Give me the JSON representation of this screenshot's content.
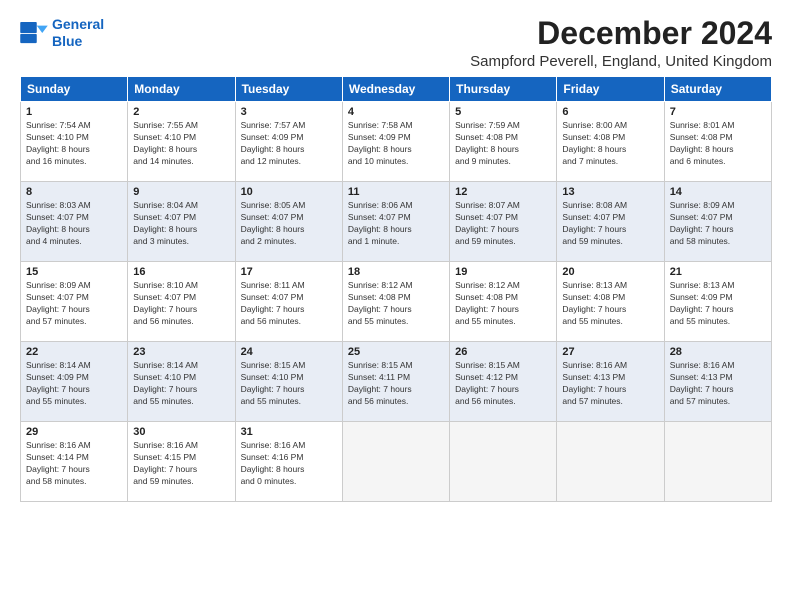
{
  "logo": {
    "line1": "General",
    "line2": "Blue"
  },
  "title": "December 2024",
  "subtitle": "Sampford Peverell, England, United Kingdom",
  "days_header": [
    "Sunday",
    "Monday",
    "Tuesday",
    "Wednesday",
    "Thursday",
    "Friday",
    "Saturday"
  ],
  "weeks": [
    [
      {
        "day": "1",
        "sunrise": "7:54 AM",
        "sunset": "4:10 PM",
        "daylight": "8 hours and 16 minutes."
      },
      {
        "day": "2",
        "sunrise": "7:55 AM",
        "sunset": "4:10 PM",
        "daylight": "8 hours and 14 minutes."
      },
      {
        "day": "3",
        "sunrise": "7:57 AM",
        "sunset": "4:09 PM",
        "daylight": "8 hours and 12 minutes."
      },
      {
        "day": "4",
        "sunrise": "7:58 AM",
        "sunset": "4:09 PM",
        "daylight": "8 hours and 10 minutes."
      },
      {
        "day": "5",
        "sunrise": "7:59 AM",
        "sunset": "4:08 PM",
        "daylight": "8 hours and 9 minutes."
      },
      {
        "day": "6",
        "sunrise": "8:00 AM",
        "sunset": "4:08 PM",
        "daylight": "8 hours and 7 minutes."
      },
      {
        "day": "7",
        "sunrise": "8:01 AM",
        "sunset": "4:08 PM",
        "daylight": "8 hours and 6 minutes."
      }
    ],
    [
      {
        "day": "8",
        "sunrise": "8:03 AM",
        "sunset": "4:07 PM",
        "daylight": "8 hours and 4 minutes."
      },
      {
        "day": "9",
        "sunrise": "8:04 AM",
        "sunset": "4:07 PM",
        "daylight": "8 hours and 3 minutes."
      },
      {
        "day": "10",
        "sunrise": "8:05 AM",
        "sunset": "4:07 PM",
        "daylight": "8 hours and 2 minutes."
      },
      {
        "day": "11",
        "sunrise": "8:06 AM",
        "sunset": "4:07 PM",
        "daylight": "8 hours and 1 minute."
      },
      {
        "day": "12",
        "sunrise": "8:07 AM",
        "sunset": "4:07 PM",
        "daylight": "7 hours and 59 minutes."
      },
      {
        "day": "13",
        "sunrise": "8:08 AM",
        "sunset": "4:07 PM",
        "daylight": "7 hours and 59 minutes."
      },
      {
        "day": "14",
        "sunrise": "8:09 AM",
        "sunset": "4:07 PM",
        "daylight": "7 hours and 58 minutes."
      }
    ],
    [
      {
        "day": "15",
        "sunrise": "8:09 AM",
        "sunset": "4:07 PM",
        "daylight": "7 hours and 57 minutes."
      },
      {
        "day": "16",
        "sunrise": "8:10 AM",
        "sunset": "4:07 PM",
        "daylight": "7 hours and 56 minutes."
      },
      {
        "day": "17",
        "sunrise": "8:11 AM",
        "sunset": "4:07 PM",
        "daylight": "7 hours and 56 minutes."
      },
      {
        "day": "18",
        "sunrise": "8:12 AM",
        "sunset": "4:08 PM",
        "daylight": "7 hours and 55 minutes."
      },
      {
        "day": "19",
        "sunrise": "8:12 AM",
        "sunset": "4:08 PM",
        "daylight": "7 hours and 55 minutes."
      },
      {
        "day": "20",
        "sunrise": "8:13 AM",
        "sunset": "4:08 PM",
        "daylight": "7 hours and 55 minutes."
      },
      {
        "day": "21",
        "sunrise": "8:13 AM",
        "sunset": "4:09 PM",
        "daylight": "7 hours and 55 minutes."
      }
    ],
    [
      {
        "day": "22",
        "sunrise": "8:14 AM",
        "sunset": "4:09 PM",
        "daylight": "7 hours and 55 minutes."
      },
      {
        "day": "23",
        "sunrise": "8:14 AM",
        "sunset": "4:10 PM",
        "daylight": "7 hours and 55 minutes."
      },
      {
        "day": "24",
        "sunrise": "8:15 AM",
        "sunset": "4:10 PM",
        "daylight": "7 hours and 55 minutes."
      },
      {
        "day": "25",
        "sunrise": "8:15 AM",
        "sunset": "4:11 PM",
        "daylight": "7 hours and 56 minutes."
      },
      {
        "day": "26",
        "sunrise": "8:15 AM",
        "sunset": "4:12 PM",
        "daylight": "7 hours and 56 minutes."
      },
      {
        "day": "27",
        "sunrise": "8:16 AM",
        "sunset": "4:13 PM",
        "daylight": "7 hours and 57 minutes."
      },
      {
        "day": "28",
        "sunrise": "8:16 AM",
        "sunset": "4:13 PM",
        "daylight": "7 hours and 57 minutes."
      }
    ],
    [
      {
        "day": "29",
        "sunrise": "8:16 AM",
        "sunset": "4:14 PM",
        "daylight": "7 hours and 58 minutes."
      },
      {
        "day": "30",
        "sunrise": "8:16 AM",
        "sunset": "4:15 PM",
        "daylight": "7 hours and 59 minutes."
      },
      {
        "day": "31",
        "sunrise": "8:16 AM",
        "sunset": "4:16 PM",
        "daylight": "8 hours and 0 minutes."
      },
      null,
      null,
      null,
      null
    ]
  ]
}
